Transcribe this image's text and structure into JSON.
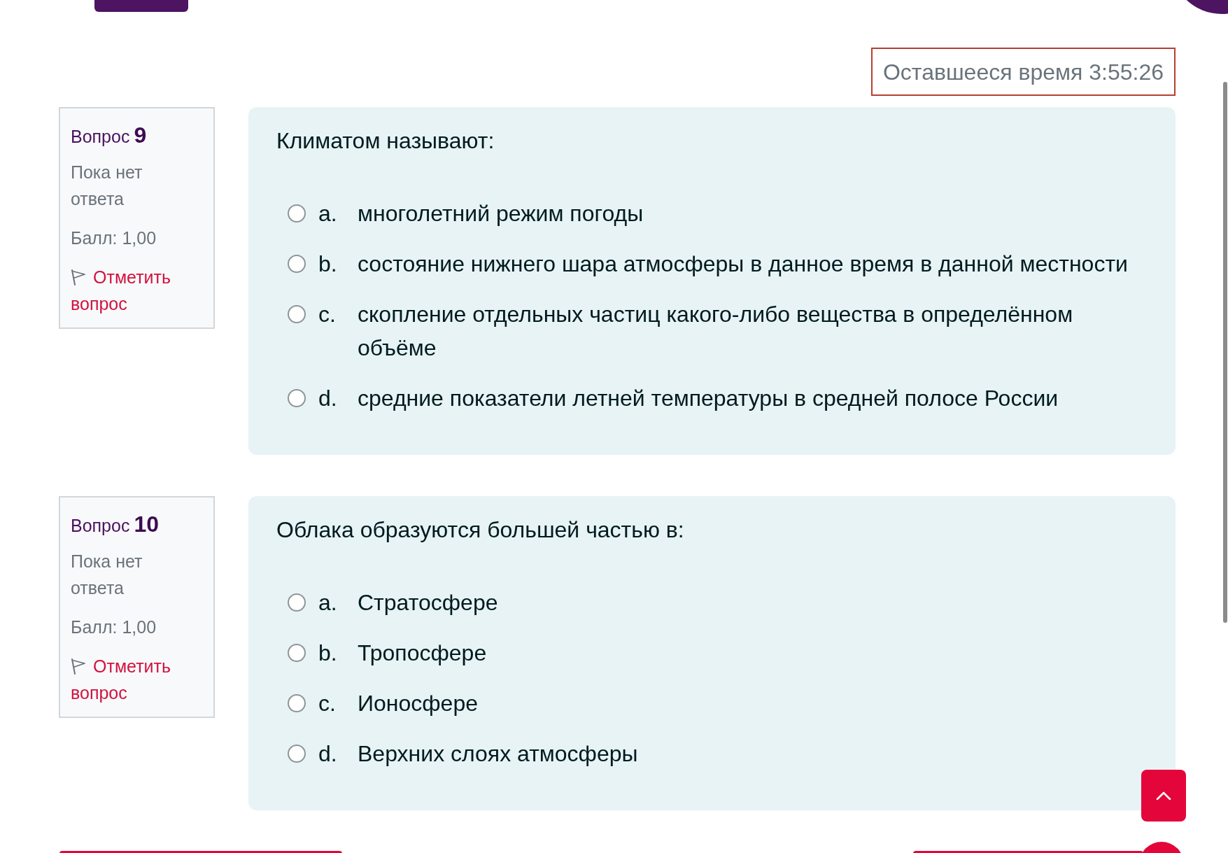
{
  "timer": {
    "text": "Оставшееся время 3:55:26"
  },
  "questions": [
    {
      "label": "Вопрос",
      "number": "9",
      "status": "Пока нет ответа",
      "mark": "Балл: 1,00",
      "flag_link": "Отметить вопрос",
      "flagged": false,
      "text": "Климатом называют:",
      "options": [
        {
          "letter": "a.",
          "text": "многолетний режим погоды",
          "selected": false
        },
        {
          "letter": "b.",
          "text": "состояние нижнего шара атмосферы в данное время в данной местности",
          "selected": false
        },
        {
          "letter": "c.",
          "text": "скопление отдельных частиц какого-либо вещества в определённом объёме",
          "selected": false
        },
        {
          "letter": "d.",
          "text": "средние показатели летней температуры в средней полосе России",
          "selected": false
        }
      ]
    },
    {
      "label": "Вопрос",
      "number": "10",
      "status": "Пока нет ответа",
      "mark": "Балл: 1,00",
      "flag_link": "Отметить вопрос",
      "flagged": false,
      "text": "Облака образуются большей частью в:",
      "options": [
        {
          "letter": "a.",
          "text": "Стратосфере",
          "selected": false
        },
        {
          "letter": "b.",
          "text": "Тропосфере",
          "selected": false
        },
        {
          "letter": "c.",
          "text": "Ионосфере",
          "selected": false
        },
        {
          "letter": "d.",
          "text": "Верхних слоях атмосферы",
          "selected": false
        }
      ]
    }
  ]
}
